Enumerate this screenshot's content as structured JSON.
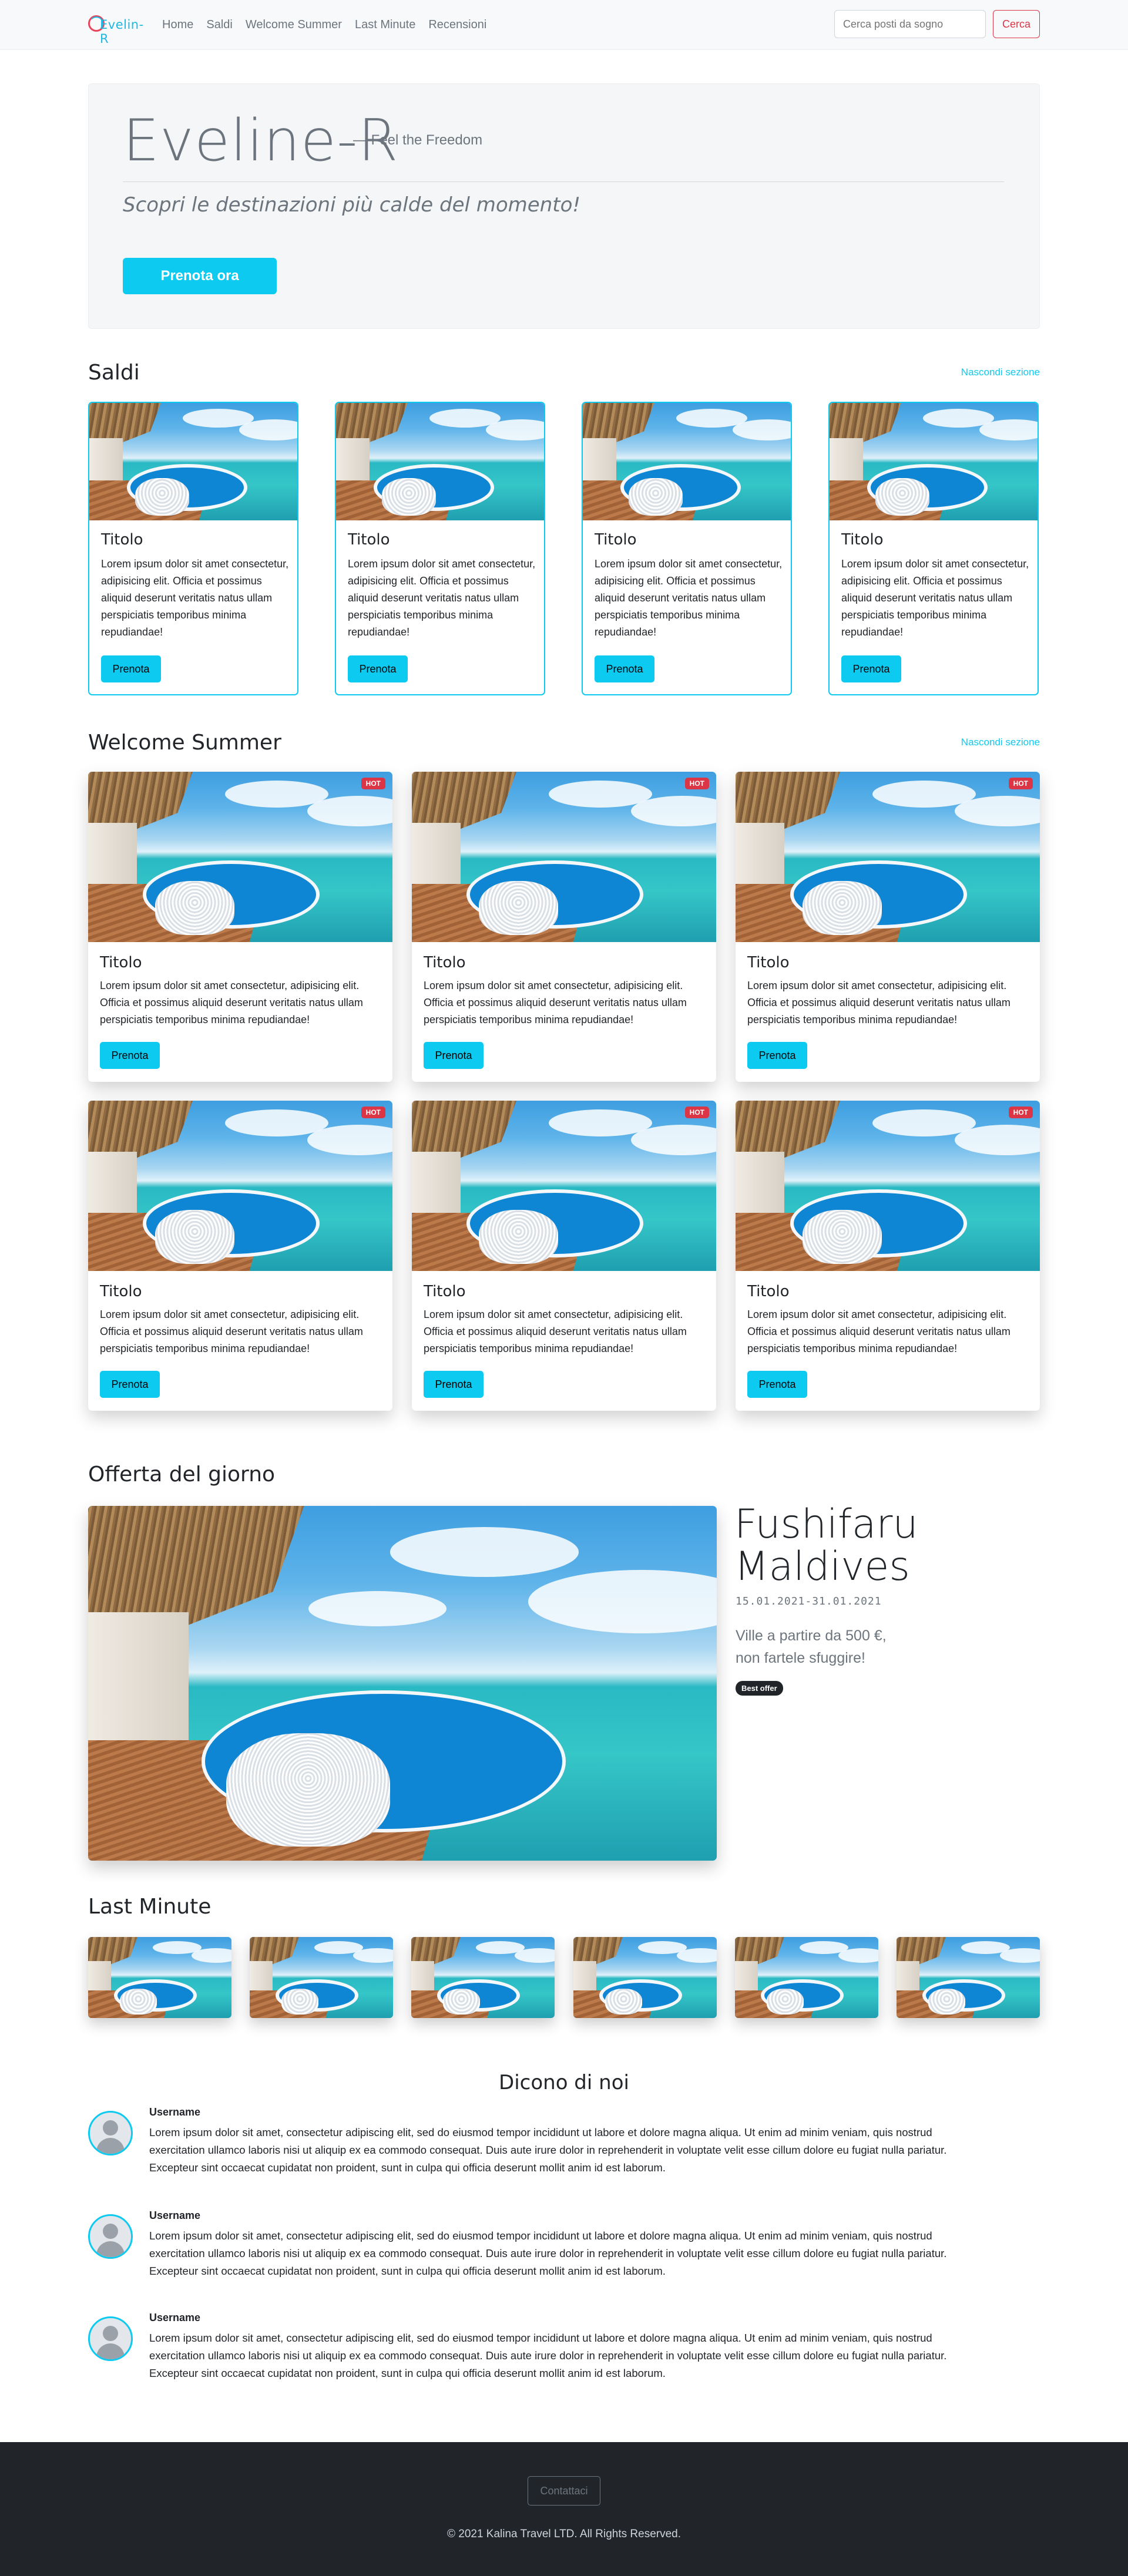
{
  "nav": {
    "brand": "Evelin-R",
    "links": [
      "Home",
      "Saldi",
      "Welcome Summer",
      "Last Minute",
      "Recensioni"
    ],
    "search_placeholder": "Cerca posti da sogno",
    "search_button": "Cerca"
  },
  "hero": {
    "title": "Eveline-R",
    "tagline": "— Feel the Freedom",
    "subtitle": "Scopri le destinazioni più calde del momento!",
    "cta": "Prenota ora"
  },
  "saldi": {
    "title": "Saldi",
    "hide_link": "Nascondi sezione",
    "cards": [
      {
        "title": "Titolo",
        "text": "Lorem ipsum dolor sit amet consectetur, adipisicing elit. Officia et possimus aliquid deserunt veritatis natus ullam perspiciatis temporibus minima repudiandae!",
        "button": "Prenota"
      },
      {
        "title": "Titolo",
        "text": "Lorem ipsum dolor sit amet consectetur, adipisicing elit. Officia et possimus aliquid deserunt veritatis natus ullam perspiciatis temporibus minima repudiandae!",
        "button": "Prenota"
      },
      {
        "title": "Titolo",
        "text": "Lorem ipsum dolor sit amet consectetur, adipisicing elit. Officia et possimus aliquid deserunt veritatis natus ullam perspiciatis temporibus minima repudiandae!",
        "button": "Prenota"
      },
      {
        "title": "Titolo",
        "text": "Lorem ipsum dolor sit amet consectetur, adipisicing elit. Officia et possimus aliquid deserunt veritatis natus ullam perspiciatis temporibus minima repudiandae!",
        "button": "Prenota"
      }
    ]
  },
  "summer": {
    "title": "Welcome Summer",
    "hide_link": "Nascondi sezione",
    "cards": [
      {
        "badge": "HOT",
        "title": "Titolo",
        "text": "Lorem ipsum dolor sit amet consectetur, adipisicing elit. Officia et possimus aliquid deserunt veritatis natus ullam perspiciatis temporibus minima repudiandae!",
        "button": "Prenota"
      },
      {
        "badge": "HOT",
        "title": "Titolo",
        "text": "Lorem ipsum dolor sit amet consectetur, adipisicing elit. Officia et possimus aliquid deserunt veritatis natus ullam perspiciatis temporibus minima repudiandae!",
        "button": "Prenota"
      },
      {
        "badge": "HOT",
        "title": "Titolo",
        "text": "Lorem ipsum dolor sit amet consectetur, adipisicing elit. Officia et possimus aliquid deserunt veritatis natus ullam perspiciatis temporibus minima repudiandae!",
        "button": "Prenota"
      },
      {
        "badge": "HOT",
        "title": "Titolo",
        "text": "Lorem ipsum dolor sit amet consectetur, adipisicing elit. Officia et possimus aliquid deserunt veritatis natus ullam perspiciatis temporibus minima repudiandae!",
        "button": "Prenota"
      },
      {
        "badge": "HOT",
        "title": "Titolo",
        "text": "Lorem ipsum dolor sit amet consectetur, adipisicing elit. Officia et possimus aliquid deserunt veritatis natus ullam perspiciatis temporibus minima repudiandae!",
        "button": "Prenota"
      },
      {
        "badge": "HOT",
        "title": "Titolo",
        "text": "Lorem ipsum dolor sit amet consectetur, adipisicing elit. Officia et possimus aliquid deserunt veritatis natus ullam perspiciatis temporibus minima repudiandae!",
        "button": "Prenota"
      }
    ]
  },
  "offer": {
    "section_title": "Offerta del giorno",
    "title_line1": "Fushifaru",
    "title_line2": "Maldives",
    "dates": "15.01.2021-31.01.2021",
    "price_line1": "Ville a partire da 500 €,",
    "price_line2": "non fartele sfuggire!",
    "badge": "Best offer"
  },
  "last_minute": {
    "title": "Last Minute"
  },
  "reviews": {
    "title": "Dicono di noi",
    "items": [
      {
        "name": "Username",
        "line1": "Lorem ipsum dolor sit amet, consectetur adipiscing elit, sed do eiusmod tempor incididunt ut labore et dolore magna aliqua. Ut enim ad minim veniam, quis nostrud",
        "line2": "exercitation ullamco laboris nisi ut aliquip ex ea commodo consequat. Duis aute irure dolor in reprehenderit in voluptate velit esse cillum dolore eu fugiat nulla pariatur.",
        "line3": "Excepteur sint occaecat cupidatat non proident, sunt in culpa qui officia deserunt mollit anim id est laborum."
      },
      {
        "name": "Username",
        "line1": "Lorem ipsum dolor sit amet, consectetur adipiscing elit, sed do eiusmod tempor incididunt ut labore et dolore magna aliqua. Ut enim ad minim veniam, quis nostrud",
        "line2": "exercitation ullamco laboris nisi ut aliquip ex ea commodo consequat. Duis aute irure dolor in reprehenderit in voluptate velit esse cillum dolore eu fugiat nulla pariatur.",
        "line3": "Excepteur sint occaecat cupidatat non proident, sunt in culpa qui officia deserunt mollit anim id est laborum."
      },
      {
        "name": "Username",
        "line1": "Lorem ipsum dolor sit amet, consectetur adipiscing elit, sed do eiusmod tempor incididunt ut labore et dolore magna aliqua. Ut enim ad minim veniam, quis nostrud",
        "line2": "exercitation ullamco laboris nisi ut aliquip ex ea commodo consequat. Duis aute irure dolor in reprehenderit in voluptate velit esse cillum dolore eu fugiat nulla pariatur.",
        "line3": "Excepteur sint occaecat cupidatat non proident, sunt in culpa qui officia deserunt mollit anim id est laborum."
      }
    ]
  },
  "footer": {
    "contact_button": "Contattaci",
    "copyright": "© 2021 Kalina Travel LTD. All Rights Reserved."
  },
  "colors": {
    "accent": "#0dcaf0",
    "danger": "#dc3545",
    "dark": "#212529",
    "muted": "#6c757d"
  },
  "icons": [
    "logo-icon",
    "avatar-icon"
  ]
}
